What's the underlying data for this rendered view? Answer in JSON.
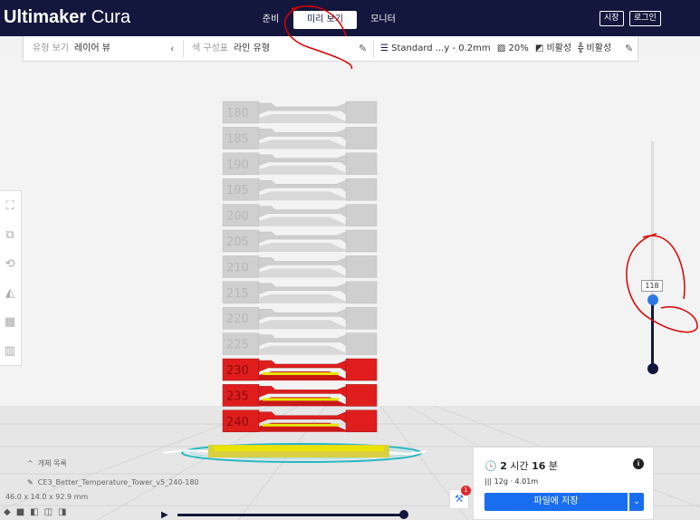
{
  "app": {
    "title_bold": "Ultimaker",
    "title_light": "Cura"
  },
  "nav": {
    "prepare": "준비",
    "preview": "미리 보기",
    "monitor": "모니터"
  },
  "header_buttons": {
    "marketplace": "시장",
    "login": "로그인"
  },
  "stagebar": {
    "view_type_label": "유형 보기",
    "view_type_value": "레이어 뷰",
    "color_scheme_label": "색 구성표",
    "color_scheme_value": "라인 유형",
    "profile": "Standard ...y - 0.2mm",
    "infill": "20%",
    "support": "비활성",
    "adhesion": "비활성"
  },
  "tower_labels": [
    "180",
    "185",
    "190",
    "195",
    "200",
    "205",
    "210",
    "215",
    "220",
    "225",
    "230",
    "235",
    "240"
  ],
  "layer_slider": {
    "current_layer": "118",
    "max_layer": 464,
    "current_layer_num": 118
  },
  "objects": {
    "header": "개체 목록",
    "file": "CE3_Better_Temperature_Tower_v5_240-180",
    "dimensions": "46.0 x 14.0 x 92.9 mm"
  },
  "print": {
    "time_hours": "2",
    "time_hours_unit": "시간",
    "time_minutes": "16",
    "time_minutes_unit": "분",
    "material": "12g · 4.01m",
    "save_button": "파일에 저장"
  },
  "notification_count": "1",
  "colors": {
    "header": "#13173d",
    "accent": "#196ef0",
    "wall": "#e01d1d",
    "skin": "#e8e400",
    "unprinted": "#cfcfcf",
    "travel": "#26b8c4"
  }
}
